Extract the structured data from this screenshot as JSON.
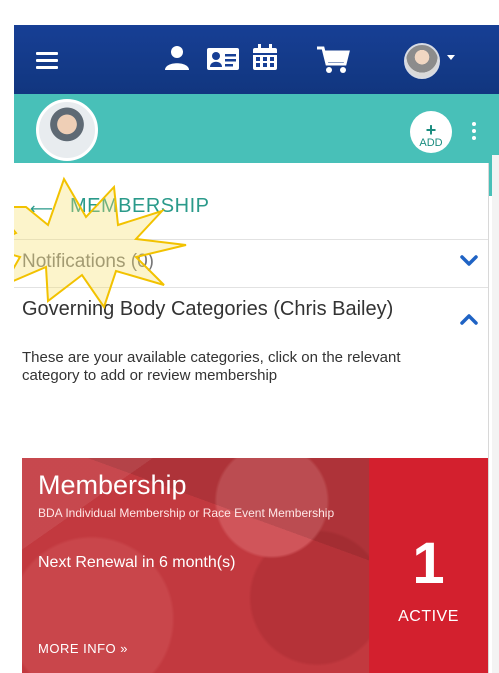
{
  "navbar": {
    "icons": [
      "menu-icon",
      "person-icon",
      "contact-card-icon",
      "calendar-icon",
      "cart-icon",
      "user-avatar",
      "chevron-down-icon"
    ]
  },
  "header": {
    "add_plus": "+",
    "add_label": "ADD"
  },
  "page": {
    "back_icon": "arrow-left-icon",
    "title": "MEMBERSHIP"
  },
  "sections": {
    "notifications_label": "Notifications (0)",
    "governing_title": "Governing Body Categories (Chris Bailey)",
    "governing_description": "These are your available categories, click on the relevant category to add or review membership"
  },
  "membership_tile": {
    "name": "Membership",
    "description": "BDA Individual Membership or Race Event Membership",
    "renewal": "Next Renewal in 6 month(s)",
    "more_info": "MORE INFO »",
    "count": "1",
    "status": "ACTIVE"
  },
  "colors": {
    "navbar": "#133a8f",
    "header_teal": "#48c0b8",
    "accent_teal": "#2a9a8a",
    "tile_red": "#c2393f",
    "tile_count_red": "#d3202e",
    "chevron_blue": "#1f63c4",
    "highlight_burst": "#f6d84a"
  }
}
